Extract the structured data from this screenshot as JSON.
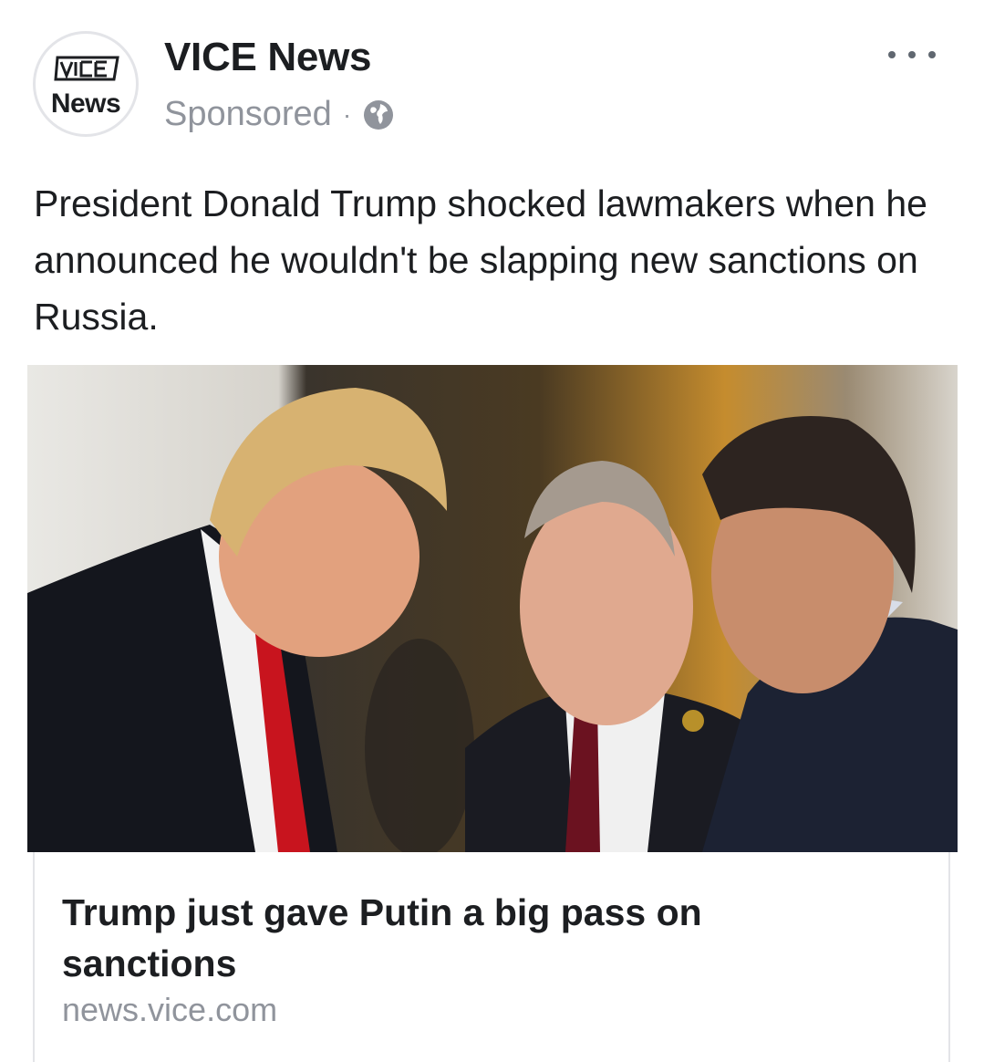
{
  "header": {
    "avatar_logo_line1": "VICE",
    "avatar_logo_line2": "News",
    "page_name": "VICE News",
    "sponsored_label": "Sponsored",
    "separator": "·",
    "audience_icon": "globe-icon",
    "more_icon": "more-options-icon"
  },
  "post": {
    "text": "President Donald Trump shocked lawmakers when he announced he wouldn't be slapping new sanctions on Russia."
  },
  "link_preview": {
    "image_subject": "news-photo",
    "title": "Trump just gave Putin a big pass on sanctions",
    "domain": "news.vice.com"
  },
  "colors": {
    "primary_text": "#1c1e21",
    "secondary_text": "#90949c",
    "border": "#e3e4e8"
  }
}
